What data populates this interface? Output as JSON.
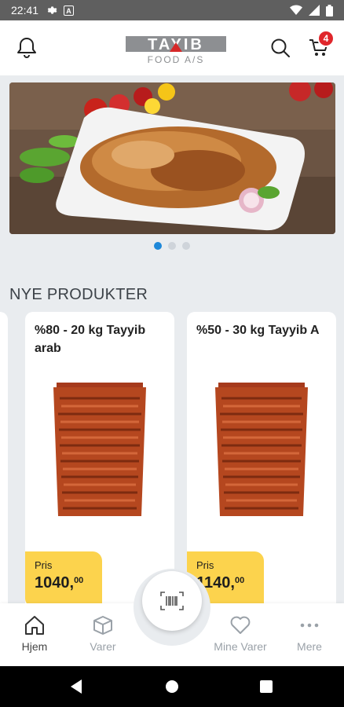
{
  "status_bar": {
    "time": "22:41"
  },
  "header": {
    "logo_text": "TAYIB",
    "logo_subtext": "FOOD A/S",
    "cart_count": "4"
  },
  "banner": {
    "slides": 3,
    "active_slide": 1
  },
  "section": {
    "title": "NYE PRODUKTER"
  },
  "products": [
    {
      "title": "%80 - 20 kg Tayyib arab",
      "price_label": "Pris",
      "price_main": "1040,",
      "price_cents": "00"
    },
    {
      "title": "%50 - 30 kg Tayyib A",
      "price_label": "Pris",
      "price_main": "1140,",
      "price_cents": "00"
    }
  ],
  "nav": {
    "home": "Hjem",
    "products": "Varer",
    "favorites": "Mine Varer",
    "more": "Mere"
  },
  "colors": {
    "accent": "#fcd34d",
    "badge": "#e0262b",
    "active_dot": "#1e88d9"
  }
}
